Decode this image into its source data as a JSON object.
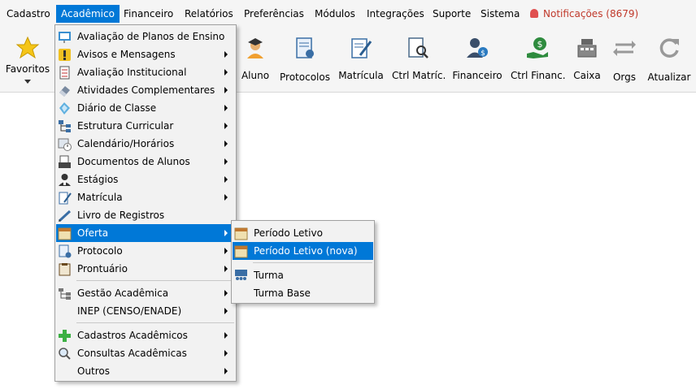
{
  "menubar": {
    "items": [
      "Cadastro",
      "Acadêmico",
      "Financeiro",
      "Relatórios",
      "Preferências",
      "Módulos",
      "Integrações",
      "Suporte",
      "Sistema"
    ],
    "notifications": "Notificações (8679)"
  },
  "toolbar": {
    "buttons": [
      "Favoritos",
      "Aluno",
      "Protocolos",
      "Matrícula",
      "Ctrl Matríc.",
      "Financeiro",
      "Ctrl Financ.",
      "Caixa",
      "Orgs",
      "Atualizar"
    ]
  },
  "academico_menu": {
    "items": [
      "Avaliação de Planos de Ensino",
      "Avisos e Mensagens",
      "Avaliação Institucional",
      "Atividades Complementares",
      "Diário de Classe",
      "Estrutura Curricular",
      "Calendário/Horários",
      "Documentos de Alunos",
      "Estágios",
      "Matrícula",
      "Livro de Registros",
      "Oferta",
      "Protocolo",
      "Prontuário",
      "Gestão Acadêmica",
      "INEP (CENSO/ENADE)",
      "Cadastros Acadêmicos",
      "Consultas Acadêmicas",
      "Outros"
    ]
  },
  "oferta_submenu": {
    "items": [
      "Período Letivo",
      "Período Letivo (nova)",
      "Turma",
      "Turma Base"
    ]
  },
  "colors": {
    "accent": "#0078d7",
    "notification": "#c0392b",
    "menu_bg": "#f2f2f2"
  }
}
